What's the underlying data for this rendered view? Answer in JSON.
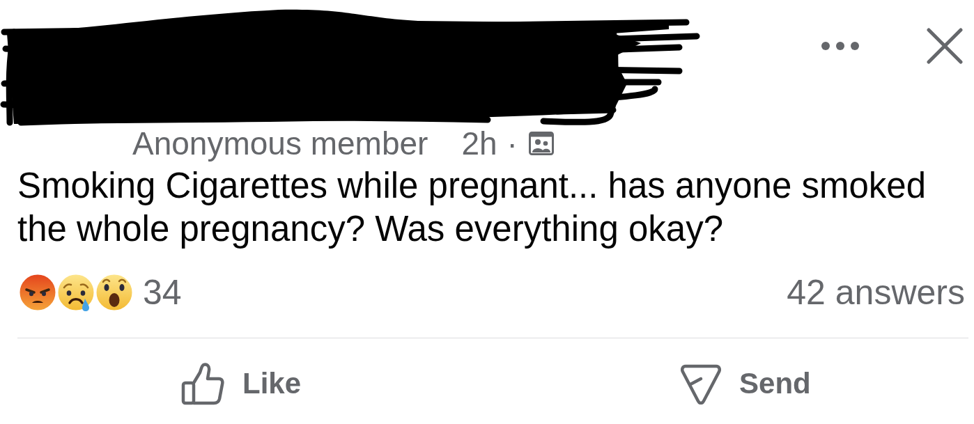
{
  "post": {
    "redacted": true,
    "author": "Anonymous member",
    "time": "2h",
    "separator": "·",
    "text": "Smoking Cigarettes while pregnant... has anyone smoked the whole pregnancy? Was everything okay?"
  },
  "reactions": {
    "types": [
      {
        "kind": "angry"
      },
      {
        "kind": "sad"
      },
      {
        "kind": "wow"
      }
    ],
    "count": "34"
  },
  "answers": "42 answers",
  "actions": [
    {
      "kind": "like",
      "label": "Like"
    },
    {
      "kind": "send",
      "label": "Send"
    }
  ]
}
